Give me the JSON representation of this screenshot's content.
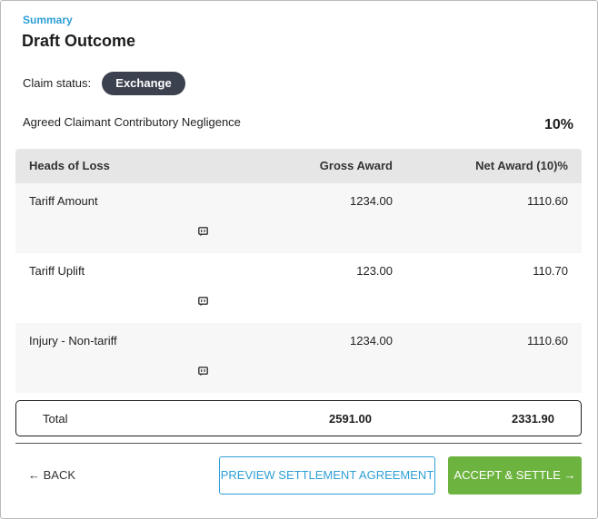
{
  "header": {
    "eyebrow": "Summary",
    "title": "Draft Outcome"
  },
  "claim": {
    "status_label": "Claim status:",
    "status_value": "Exchange"
  },
  "negligence": {
    "label": "Agreed Claimant Contributory Negligence",
    "value": "10%"
  },
  "table": {
    "headers": [
      "Heads of Loss",
      "Gross Award",
      "Net Award (10)%"
    ],
    "rows": [
      {
        "head": "Tariff Amount",
        "gross": "1234.00",
        "net": "1110.60"
      },
      {
        "head": "Tariff Uplift",
        "gross": "123.00",
        "net": "110.70"
      },
      {
        "head": "Injury - Non-tariff",
        "gross": "1234.00",
        "net": "1110.60"
      }
    ],
    "total": {
      "label": "Total",
      "gross": "2591.00",
      "net": "2331.90"
    }
  },
  "footer": {
    "back_label": "← BACK",
    "preview_label": "PREVIEW SETTLEMENT AGREEMENT",
    "accept_label": "ACCEPT & SETTLE →"
  },
  "icons": {
    "row_comment": "comment-icon"
  },
  "colors": {
    "accent": "#2e9fd6",
    "pill": "#3b414e",
    "primary_button": "#6db33f",
    "table_header": "#e6e6e6",
    "row_alt": "#f7f7f7"
  }
}
